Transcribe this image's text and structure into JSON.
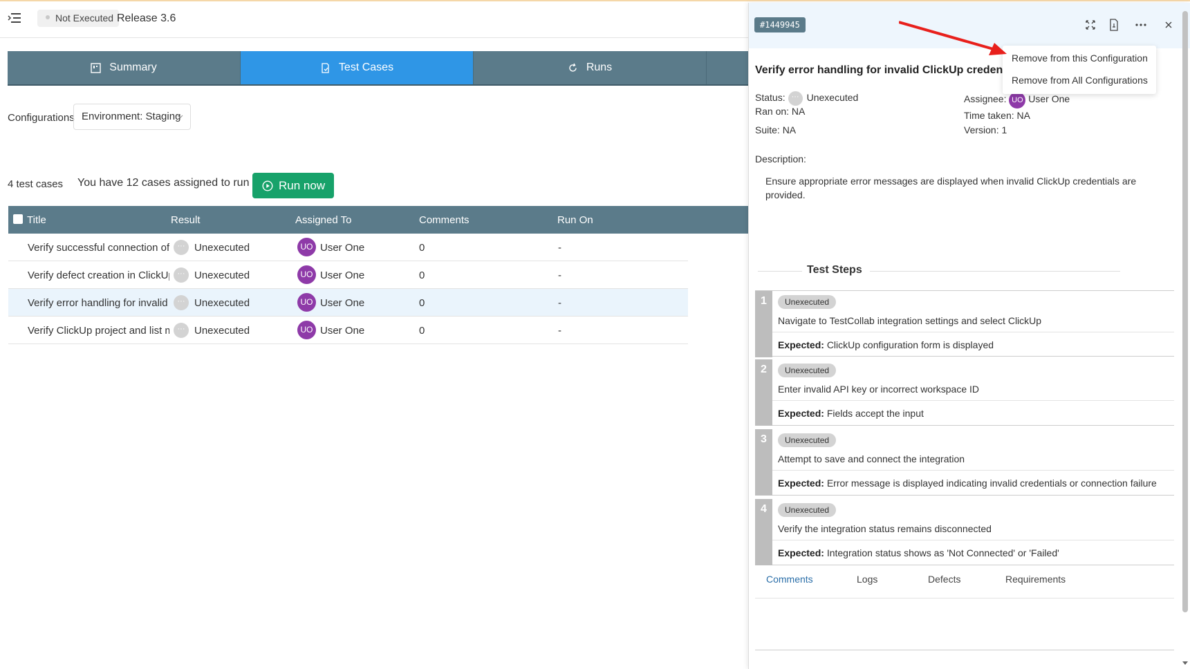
{
  "topbar": {
    "status": "Not Executed",
    "release": "Release 3.6"
  },
  "tabs": [
    {
      "label": "Summary",
      "icon": "summary-icon",
      "active": false
    },
    {
      "label": "Test Cases",
      "icon": "test-cases-icon",
      "active": true
    },
    {
      "label": "Runs",
      "icon": "refresh-icon",
      "active": false
    }
  ],
  "config": {
    "label": "Configurations",
    "value": "Environment: Staging"
  },
  "summary": {
    "count": "4 test cases",
    "assigned": "You have 12 cases assigned to run",
    "run_now": "Run now"
  },
  "table": {
    "headers": [
      "Title",
      "Result",
      "Assigned To",
      "Comments",
      "Run On"
    ],
    "rows": [
      {
        "title": "Verify successful connection of",
        "result": "Unexecuted",
        "initials": "UO",
        "assignee": "User One",
        "comments": "0",
        "run_on": "-"
      },
      {
        "title": "Verify defect creation in ClickUp",
        "result": "Unexecuted",
        "initials": "UO",
        "assignee": "User One",
        "comments": "0",
        "run_on": "-"
      },
      {
        "title": "Verify error handling for invalid",
        "result": "Unexecuted",
        "initials": "UO",
        "assignee": "User One",
        "comments": "0",
        "run_on": "-"
      },
      {
        "title": "Verify ClickUp project and list m",
        "result": "Unexecuted",
        "initials": "UO",
        "assignee": "User One",
        "comments": "0",
        "run_on": "-"
      }
    ]
  },
  "panel": {
    "id": "#1449945",
    "title": "Verify error handling for invalid ClickUp credentials",
    "status_label": "Status:",
    "status_value": "Unexecuted",
    "ran_on": "Ran on: NA",
    "suite": "Suite: NA",
    "assignee_label": "Assignee:",
    "assignee_initials": "UO",
    "assignee_name": "User One",
    "time_taken": "Time taken: NA",
    "version": "Version: 1",
    "description_label": "Description:",
    "description": "Ensure appropriate error messages are displayed when invalid ClickUp credentials are provided.",
    "steps_title": "Test Steps",
    "expected_label": "Expected:",
    "steps": [
      {
        "num": "1",
        "status": "Unexecuted",
        "action": "Navigate to TestCollab integration settings and select ClickUp",
        "expected": "ClickUp configuration form is displayed"
      },
      {
        "num": "2",
        "status": "Unexecuted",
        "action": "Enter invalid API key or incorrect workspace ID",
        "expected": "Fields accept the input"
      },
      {
        "num": "3",
        "status": "Unexecuted",
        "action": "Attempt to save and connect the integration",
        "expected": "Error message is displayed indicating invalid credentials or connection failure"
      },
      {
        "num": "4",
        "status": "Unexecuted",
        "action": "Verify the integration status remains disconnected",
        "expected": "Integration status shows as 'Not Connected' or 'Failed'"
      }
    ],
    "bottom_tabs": [
      "Comments",
      "Logs",
      "Defects",
      "Requirements"
    ]
  },
  "dropdown": {
    "items": [
      "Remove from this Configuration",
      "Remove from All Configurations"
    ]
  },
  "colors": {
    "tab_bg": "#5b7b8a",
    "tab_active": "#2f96e6",
    "run_btn": "#17a26a",
    "avatar": "#8e3aa8",
    "arrow": "#e8201c"
  }
}
